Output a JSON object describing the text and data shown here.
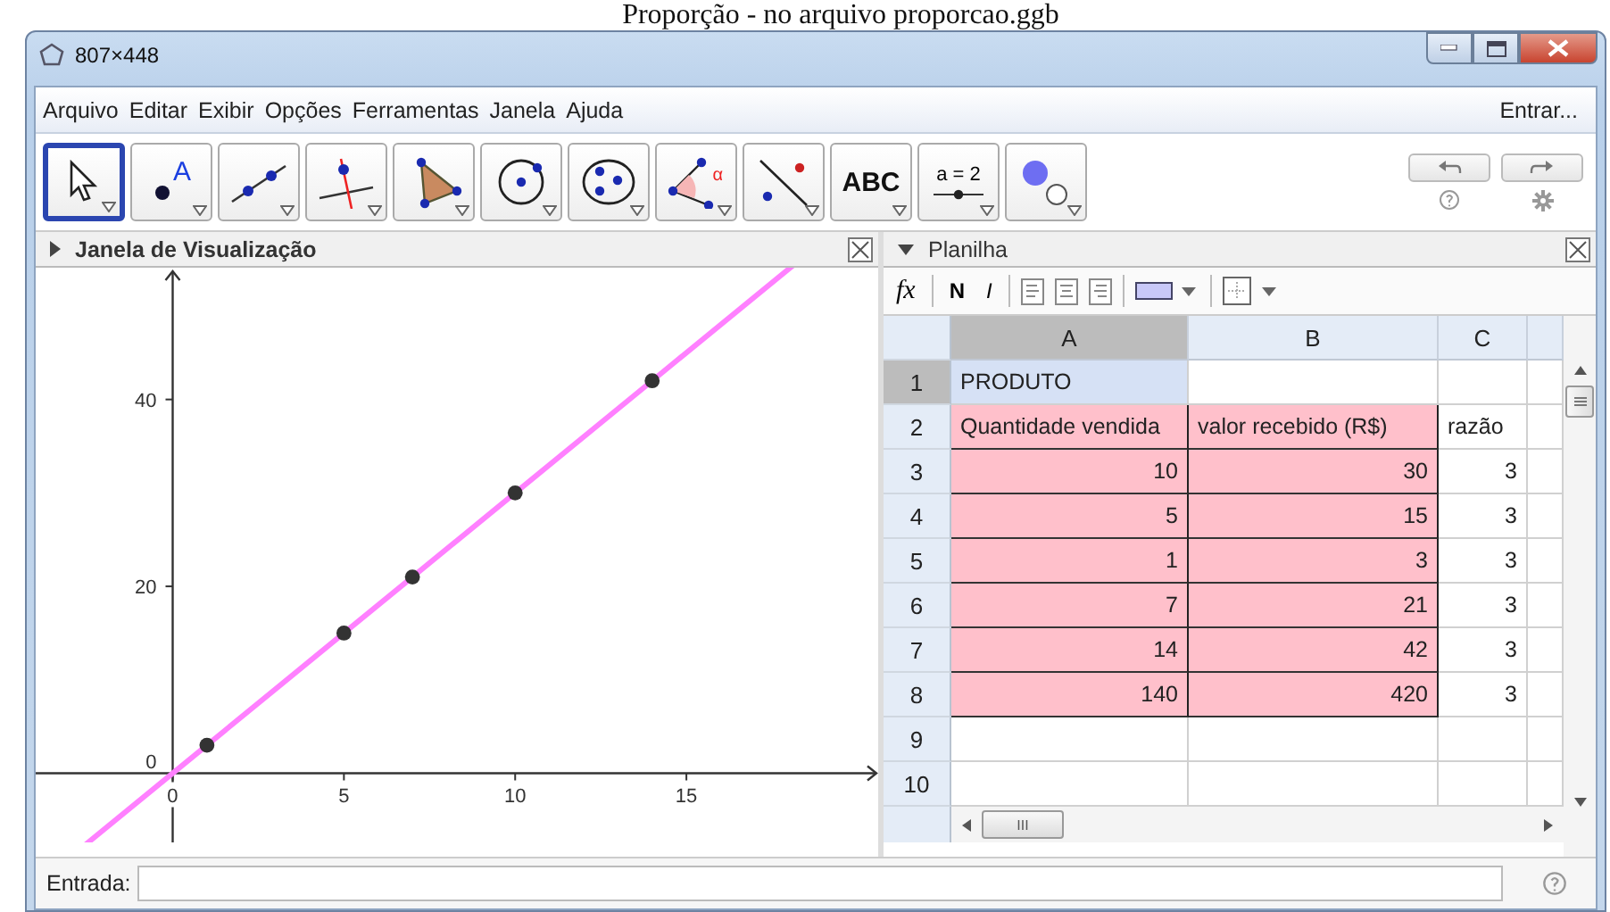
{
  "caption": "Proporção - no arquivo proporcao.ggb",
  "window": {
    "title": "807×448"
  },
  "menu": [
    "Arquivo",
    "Editar",
    "Exibir",
    "Opções",
    "Ferramentas",
    "Janela",
    "Ajuda"
  ],
  "login": "Entrar...",
  "tools": [
    {
      "kind": "move",
      "selected": true
    },
    {
      "kind": "point",
      "label": "A",
      "selected": false
    },
    {
      "kind": "line",
      "selected": false
    },
    {
      "kind": "perpendicular",
      "selected": false
    },
    {
      "kind": "polygon",
      "selected": false
    },
    {
      "kind": "circle",
      "selected": false
    },
    {
      "kind": "ellipse",
      "selected": false
    },
    {
      "kind": "angle",
      "label": "α",
      "selected": false
    },
    {
      "kind": "reflect",
      "selected": false
    },
    {
      "kind": "text",
      "label": "ABC",
      "selected": false
    },
    {
      "kind": "slider",
      "label": "a = 2",
      "selected": false
    },
    {
      "kind": "show",
      "selected": false
    }
  ],
  "graphics": {
    "title": "Janela de Visualização",
    "chart_data": {
      "type": "scatter",
      "xlim": [
        -4,
        20.6
      ],
      "ylim": [
        -7.4,
        54.1
      ],
      "xticks": [
        0,
        5,
        10,
        15
      ],
      "yticks": [
        0,
        20,
        40
      ],
      "x": [
        1,
        5,
        7,
        10,
        14
      ],
      "series": [
        {
          "type": "scatter",
          "color": "#333333",
          "values": [
            3,
            15,
            21,
            30,
            42
          ]
        },
        {
          "type": "line",
          "color": "#ff80ff",
          "values": [
            3,
            15,
            21,
            30,
            42
          ]
        }
      ]
    }
  },
  "spreadsheet": {
    "title": "Planilha",
    "format": {
      "fx": "fx",
      "bold": "N",
      "italic": "I"
    },
    "columns": [
      {
        "label": "A",
        "selected": true
      },
      {
        "label": "B",
        "selected": false
      },
      {
        "label": "C",
        "selected": false
      }
    ],
    "rows": [
      {
        "label": "1",
        "selected": true,
        "cells": [
          {
            "text": "PRODUTO",
            "kind": "text",
            "selected": true,
            "highlighted": false
          },
          {
            "highlighted": false,
            "selected": false
          },
          {
            "highlighted": false,
            "selected": false
          }
        ]
      },
      {
        "label": "2",
        "selected": false,
        "cells": [
          {
            "text": "Quantidade vendida",
            "kind": "text",
            "selected": false,
            "highlighted": true
          },
          {
            "text": "valor recebido (R$)",
            "kind": "text",
            "selected": false,
            "highlighted": true
          },
          {
            "text": "razão",
            "kind": "text",
            "selected": false,
            "highlighted": false
          }
        ]
      },
      {
        "label": "3",
        "selected": false,
        "cells": [
          {
            "text": "10",
            "kind": "number",
            "selected": false,
            "highlighted": true
          },
          {
            "text": "30",
            "kind": "number",
            "selected": false,
            "highlighted": true
          },
          {
            "text": "3",
            "kind": "number",
            "selected": false,
            "highlighted": false
          }
        ]
      },
      {
        "label": "4",
        "selected": false,
        "cells": [
          {
            "text": "5",
            "kind": "number",
            "selected": false,
            "highlighted": true
          },
          {
            "text": "15",
            "kind": "number",
            "selected": false,
            "highlighted": true
          },
          {
            "text": "3",
            "kind": "number",
            "selected": false,
            "highlighted": false
          }
        ]
      },
      {
        "label": "5",
        "selected": false,
        "cells": [
          {
            "text": "1",
            "kind": "number",
            "selected": false,
            "highlighted": true
          },
          {
            "text": "3",
            "kind": "number",
            "selected": false,
            "highlighted": true
          },
          {
            "text": "3",
            "kind": "number",
            "selected": false,
            "highlighted": false
          }
        ]
      },
      {
        "label": "6",
        "selected": false,
        "cells": [
          {
            "text": "7",
            "kind": "number",
            "selected": false,
            "highlighted": true
          },
          {
            "text": "21",
            "kind": "number",
            "selected": false,
            "highlighted": true
          },
          {
            "text": "3",
            "kind": "number",
            "selected": false,
            "highlighted": false
          }
        ]
      },
      {
        "label": "7",
        "selected": false,
        "cells": [
          {
            "text": "14",
            "kind": "number",
            "selected": false,
            "highlighted": true
          },
          {
            "text": "42",
            "kind": "number",
            "selected": false,
            "highlighted": true
          },
          {
            "text": "3",
            "kind": "number",
            "selected": false,
            "highlighted": false
          }
        ]
      },
      {
        "label": "8",
        "selected": false,
        "cells": [
          {
            "text": "140",
            "kind": "number",
            "selected": false,
            "highlighted": true
          },
          {
            "text": "420",
            "kind": "number",
            "selected": false,
            "highlighted": true
          },
          {
            "text": "3",
            "kind": "number",
            "selected": false,
            "highlighted": false
          }
        ]
      },
      {
        "label": "9",
        "selected": false
      },
      {
        "label": "10",
        "selected": false
      }
    ],
    "scroll_grip": "III"
  },
  "input": {
    "label": "Entrada:"
  }
}
